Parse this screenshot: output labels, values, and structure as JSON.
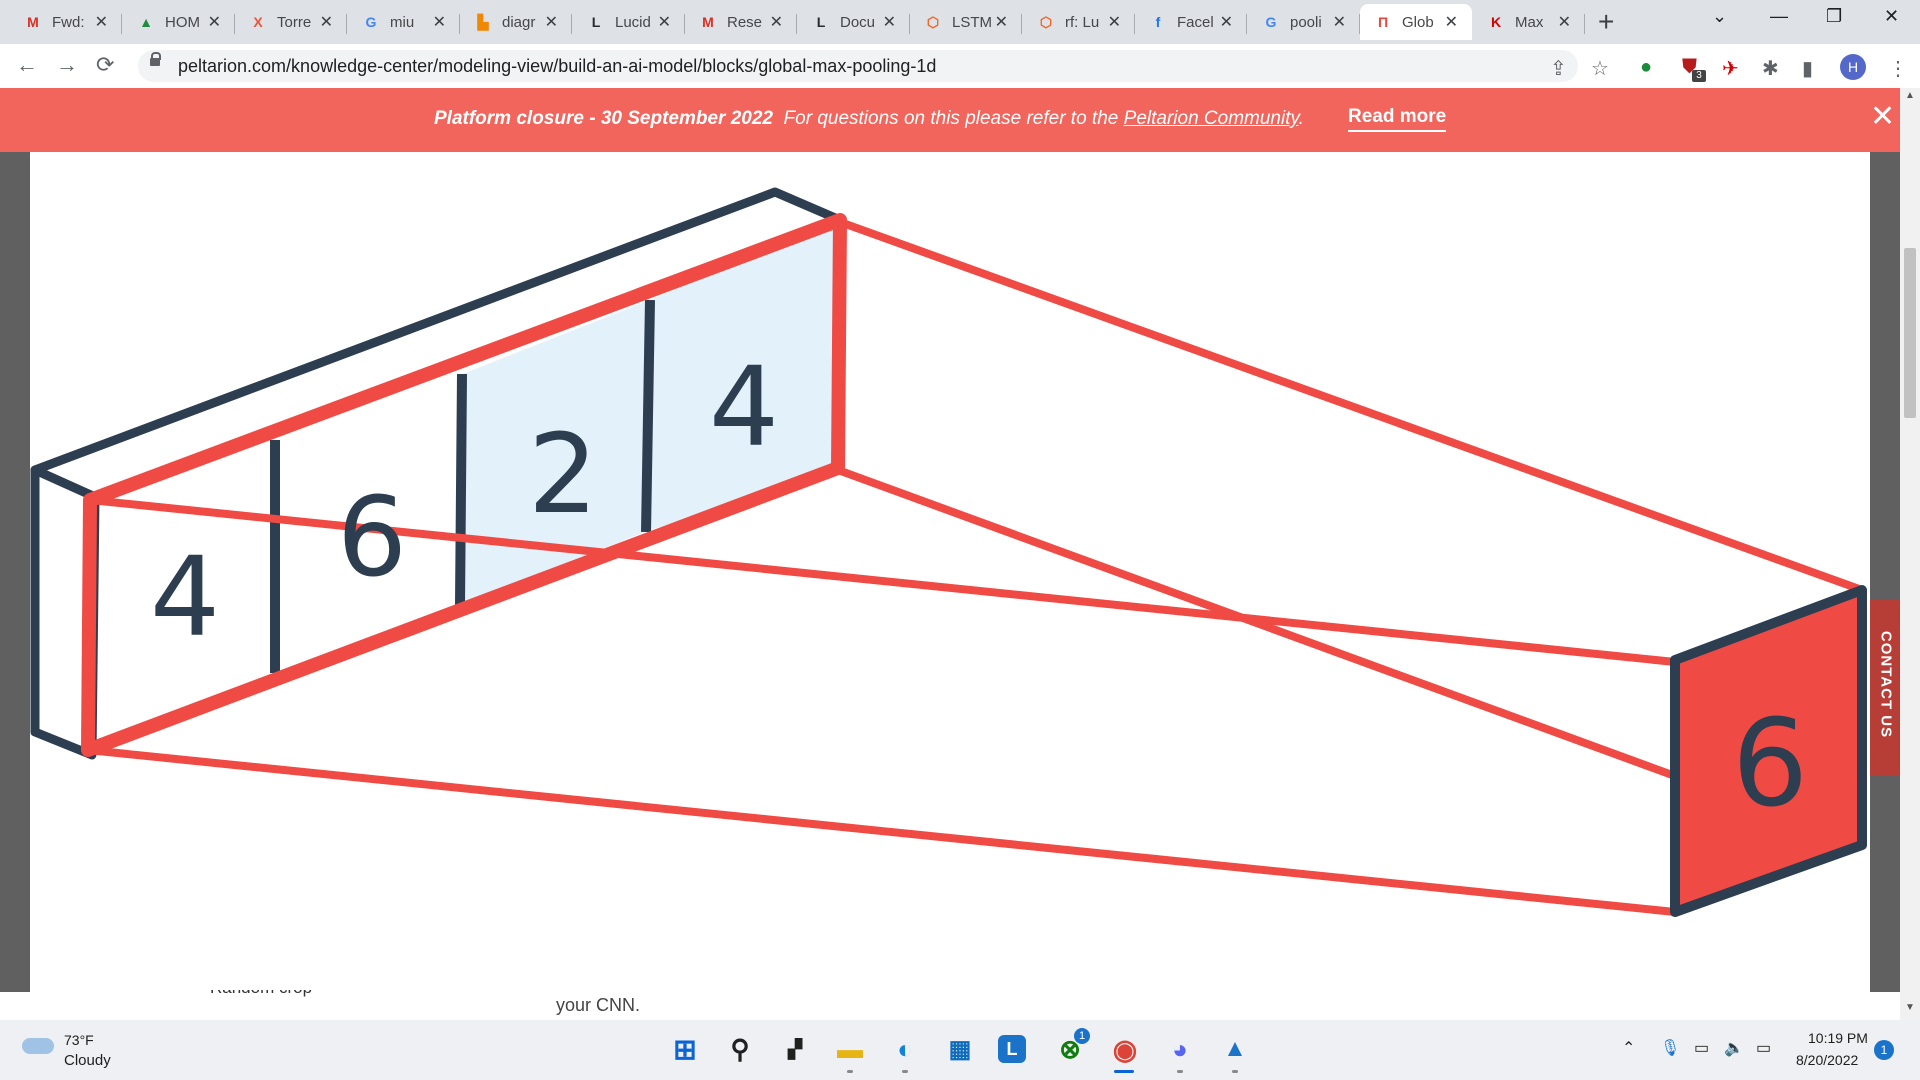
{
  "browser": {
    "tabs": [
      {
        "title": "Fwd:",
        "icon": "gmail-icon",
        "glyph": "M",
        "color": "#d93025"
      },
      {
        "title": "HOM",
        "icon": "google-drive-icon",
        "glyph": "▲",
        "color": "#1e8e3e"
      },
      {
        "title": "Torre",
        "icon": "x-brand-icon",
        "glyph": "X",
        "color": "#e8573a"
      },
      {
        "title": "miu",
        "icon": "google-icon",
        "glyph": "G",
        "color": "#4285f4"
      },
      {
        "title": "diagr",
        "icon": "diagrams-icon",
        "glyph": "▙",
        "color": "#f08705"
      },
      {
        "title": "Lucid",
        "icon": "lucid-icon",
        "glyph": "L",
        "color": "#282c33"
      },
      {
        "title": "Rese",
        "icon": "gmail-icon",
        "glyph": "M",
        "color": "#d93025"
      },
      {
        "title": "Docu",
        "icon": "lucid-icon",
        "glyph": "L",
        "color": "#282c33"
      },
      {
        "title": "LSTM",
        "icon": "hexagon-icon",
        "glyph": "⬡",
        "color": "#f26522"
      },
      {
        "title": "rf: Lu",
        "icon": "hexagon-icon",
        "glyph": "⬡",
        "color": "#f26522"
      },
      {
        "title": "Facel",
        "icon": "facebook-icon",
        "glyph": "f",
        "color": "#1877f2"
      },
      {
        "title": "pooli",
        "icon": "google-icon",
        "glyph": "G",
        "color": "#4285f4"
      },
      {
        "title": "Glob",
        "icon": "peltarion-icon",
        "glyph": "Π",
        "color": "#e9463f",
        "active": true
      },
      {
        "title": "Max",
        "icon": "k-brand-icon",
        "glyph": "K",
        "color": "#d50000"
      }
    ],
    "new_tab_label": "+",
    "url": "peltarion.com/knowledge-center/modeling-view/build-an-ai-model/blocks/global-max-pooling-1d",
    "profile_initial": "H",
    "extension_badge": "3"
  },
  "banner": {
    "bold_text": "Platform closure - 30 September 2022",
    "text": "For questions on this please refer to the",
    "link_text": "Peltarion Community",
    "period": ".",
    "read_more": "Read more"
  },
  "diagram": {
    "input_values": [
      "4",
      "6",
      "2",
      "4"
    ],
    "output_value": "6",
    "colors": {
      "dark": "#2c3e50",
      "red": "#f04a44",
      "highlight": "#e3f1fa",
      "white": "#ffffff"
    }
  },
  "page": {
    "fragment_left": "Random crop",
    "fragment_right": "your CNN.",
    "contact_label": "CONTACT US"
  },
  "taskbar": {
    "temperature": "73°F",
    "condition": "Cloudy",
    "time": "10:19 PM",
    "date": "8/20/2022",
    "notifications": "1",
    "xbox_badge": "1"
  }
}
